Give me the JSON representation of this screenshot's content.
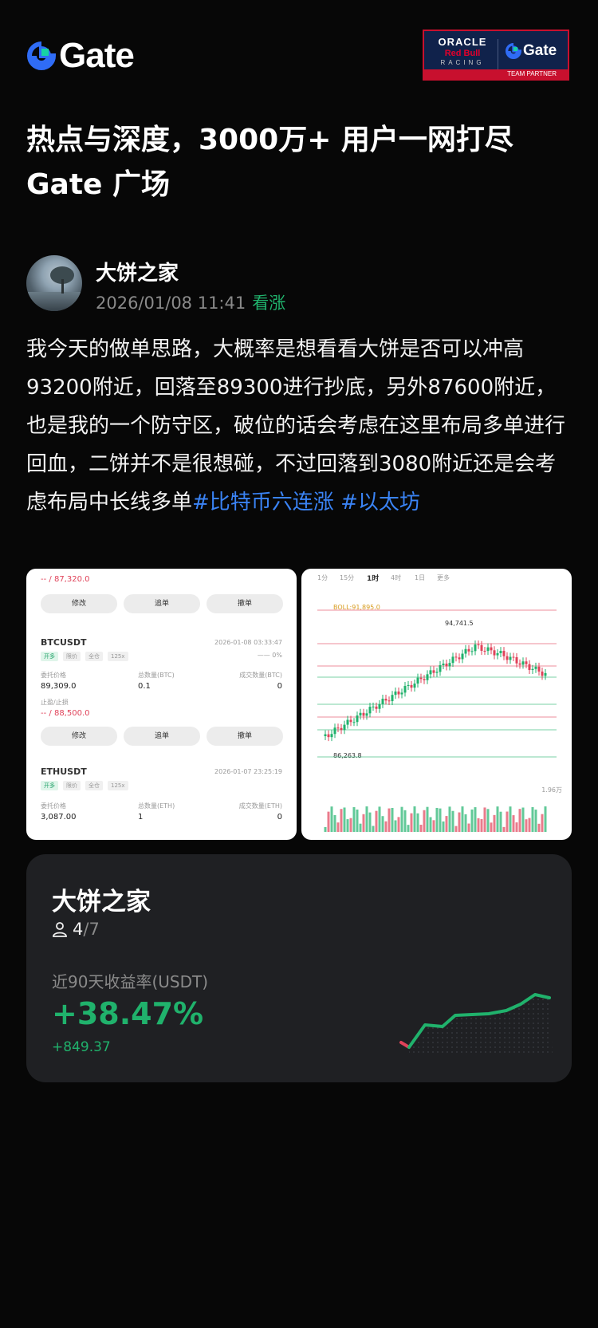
{
  "brand": {
    "name": "Gate",
    "accent": "#2f6cf6",
    "icon": "gate-logo-icon"
  },
  "partner": {
    "oracle": "ORACLE",
    "redbull": "Red Bull",
    "racing": "RACING",
    "gate": "Gate",
    "tag": "TEAM PARTNER"
  },
  "headline": {
    "line1": "热点与深度，3000万+ 用户一网打尽",
    "line2": "Gate 广场"
  },
  "post": {
    "author": "大饼之家",
    "timestamp": "2026/01/08 11:41",
    "sentiment": "看涨",
    "body": "我今天的做单思路，大概率是想看看大饼是否可以冲高93200附近，回落至89300进行抄底，另外87600附近，也是我的一个防守区，破位的话会考虑在这里布局多单进行回血，二饼并不是很想碰，不过回落到3080附近还是会考虑布局中长线多单",
    "hashtags": [
      "#比特币六连涨",
      "#以太坊"
    ]
  },
  "screenshot_left": {
    "top_value": "87,320.0",
    "buttons": [
      "修改",
      "追单",
      "撤单"
    ],
    "orders": [
      {
        "symbol": "BTCUSDT",
        "time": "2026-01-08 03:33:47",
        "progress": "0%",
        "chips": [
          "开多",
          "限价",
          "全仓",
          "125x"
        ],
        "price_label": "委托价格",
        "price": "89,309.0",
        "qty_label": "总数量(BTC)",
        "qty": "0.1",
        "filled_label": "成交数量(BTC)",
        "filled": "0",
        "tpsl_label": "止盈/止损",
        "tpsl": "88,500.0"
      },
      {
        "symbol": "ETHUSDT",
        "time": "2026-01-07 23:25:19",
        "chips": [
          "开多",
          "限价",
          "全仓",
          "125x"
        ],
        "price_label": "委托价格",
        "price": "3,087.00",
        "qty_label": "总数量(ETH)",
        "qty": "1",
        "filled_label": "成交数量(ETH)",
        "filled": "0"
      }
    ]
  },
  "screenshot_right": {
    "timeframes": [
      "1分",
      "15分",
      "1时",
      "4时",
      "1日",
      "更多"
    ],
    "indicator": "BOLL:91,895.0",
    "high_label": "94,741.5",
    "low_label": "86,263.8",
    "vol_label": "1.96万"
  },
  "card": {
    "title": "大饼之家",
    "users_current": "4",
    "users_total": "/7",
    "label": "近90天收益率(USDT)",
    "pct": "+38.47%",
    "abs": "+849.37",
    "green": "#20b26c",
    "red": "#e0435a"
  }
}
